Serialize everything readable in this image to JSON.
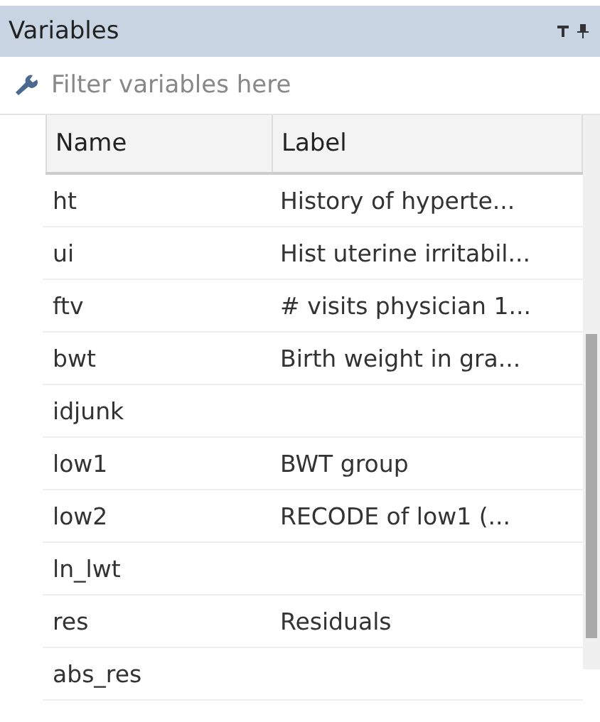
{
  "panel": {
    "title": "Variables"
  },
  "filter": {
    "placeholder": "Filter variables here"
  },
  "table": {
    "columns": [
      "Name",
      "Label"
    ],
    "rows": [
      {
        "name": "ht",
        "label": "History of hyperte..."
      },
      {
        "name": "ui",
        "label": "Hist uterine irritabil..."
      },
      {
        "name": "ftv",
        "label": "# visits physician 1..."
      },
      {
        "name": "bwt",
        "label": "Birth weight in gra..."
      },
      {
        "name": "idjunk"
      },
      {
        "name": "low1",
        "label": "BWT group"
      },
      {
        "name": "low2",
        "label": "RECODE of low1 (..."
      },
      {
        "name": "ln_lwt"
      },
      {
        "name": "res",
        "label": "Residuals"
      },
      {
        "name": "abs_res"
      }
    ]
  }
}
